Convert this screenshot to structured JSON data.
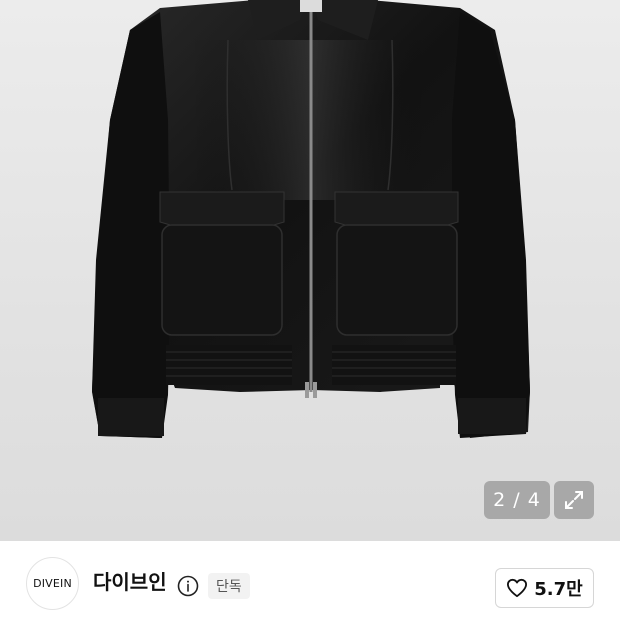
{
  "gallery": {
    "counter": "2 / 4",
    "image_alt": "black leather jacket"
  },
  "brand": {
    "logo_text": "DIVEIN",
    "name": "다이브인",
    "badge": "단독",
    "likes": "5.7만"
  },
  "icons": {
    "expand": "expand-icon",
    "info": "info-icon",
    "heart": "heart-icon"
  },
  "colors": {
    "hero_bg": "#e4e4e4",
    "jacket": "#151515",
    "overlay": "#969696"
  }
}
